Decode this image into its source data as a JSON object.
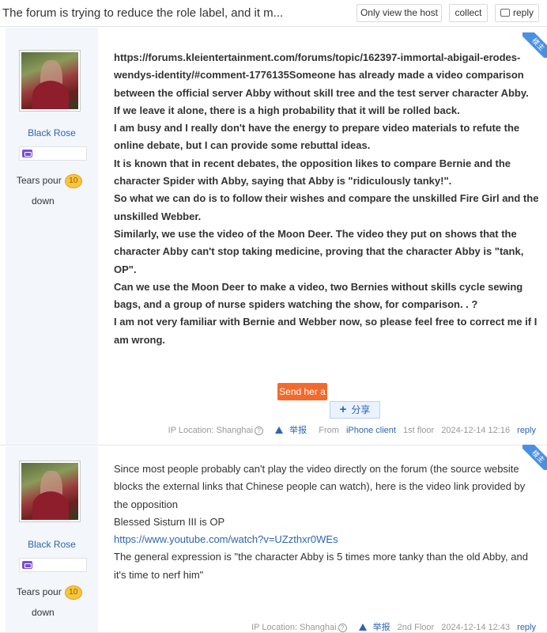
{
  "header": {
    "title": "The forum is trying to reduce the role label, and it m...",
    "only_host": "Only view the host",
    "collect": "collect",
    "reply": "reply"
  },
  "posts": [
    {
      "badge": "楼主",
      "username": "Black Rose",
      "fans_label": "Tears pour",
      "fans_level": "10",
      "fans_sub": "down",
      "lines": [
        "https://forums.kleientertainment.com/forums/topic/162397-immortal-abigail-erodes-wendys-identity/#comment-1776135Someone has already made a video comparison between the official server Abby without skill tree and the test server character Abby.",
        "If we leave it alone, there is a high probability that it will be rolled back.",
        "I am busy and I really don't have the energy to prepare video materials to refute the online debate, but I can provide some rebuttal ideas.",
        "It is known that in recent debates, the opposition likes to compare Bernie and the character Spider with Abby, saying that Abby is \"ridiculously tanky!\".",
        "So what we can do is to follow their wishes and compare the unskilled Fire Girl and the unskilled Webber.",
        "Similarly, we use the video of the Moon Deer. The video they put on shows that the character Abby can't stop taking medicine, proving that the character Abby is \"tank, OP\".",
        "Can we use the Moon Deer to make a video, two Bernies without skills cycle sewing bags, and a group of nurse spiders watching the show, for comparison. . ?",
        "I am not very familiar with Bernie and Webber now, so please feel free to correct me if I am wrong."
      ],
      "send_button": "Send her a",
      "share_button": "分享",
      "ip": "IP Location: Shanghai",
      "report": "举报",
      "from": "From",
      "client": "iPhone client",
      "floor": "1st floor",
      "time": "2024-12-14 12:16",
      "reply": "reply"
    },
    {
      "badge": "楼主",
      "username": "Black Rose",
      "fans_label": "Tears pour",
      "fans_level": "10",
      "fans_sub": "down",
      "line1": "Since most people probably can't play the video directly on the forum (the source website blocks the external links that Chinese people can watch), here is the video link provided by the opposition",
      "line2": "Blessed Sisturn III is OP",
      "link": "https://www.youtube.com/watch?v=UZzthxr0WEs",
      "line3": "The general expression is \"the character Abby is 5 times more tanky than the old Abby, and it's time to nerf him\"",
      "ip": "IP Location: Shanghai",
      "report": "举报",
      "floor": "2nd Floor",
      "time": "2024-12-14 12:43",
      "reply": "reply"
    }
  ]
}
